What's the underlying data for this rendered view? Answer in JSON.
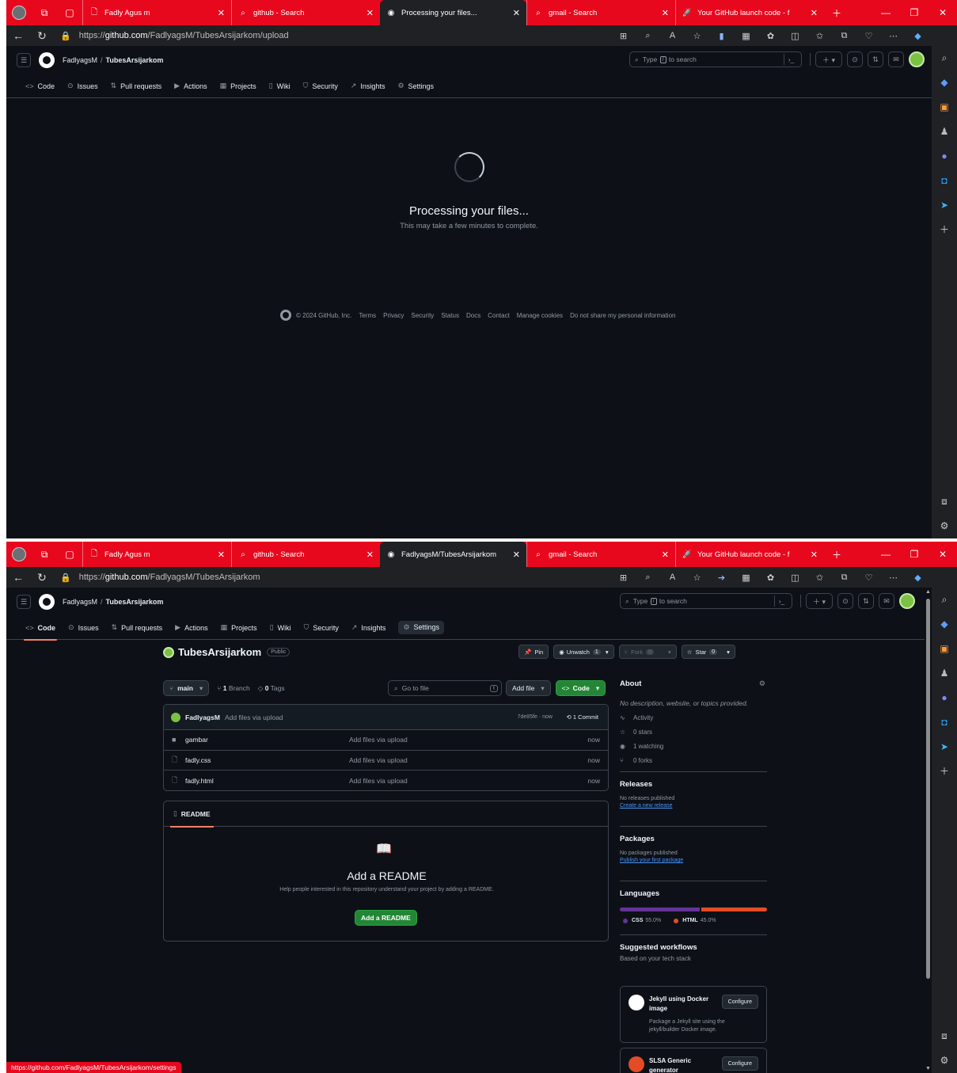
{
  "browser": {
    "tabs_top": [
      {
        "label": "Fadly Agus m",
        "icon": "page-icon"
      },
      {
        "label": "github - Search",
        "icon": "search-icon"
      },
      {
        "label": "Processing your files...",
        "icon": "github-icon",
        "active": true
      },
      {
        "label": "gmail - Search",
        "icon": "search-icon"
      },
      {
        "label": "Your GitHub launch code - f",
        "icon": "rocket-icon"
      }
    ],
    "tabs_bottom": [
      {
        "label": "Fadly Agus m",
        "icon": "page-icon"
      },
      {
        "label": "github - Search",
        "icon": "search-icon"
      },
      {
        "label": "FadlyagsM/TubesArsijarkom",
        "icon": "github-icon",
        "active": true
      },
      {
        "label": "gmail - Search",
        "icon": "search-icon"
      },
      {
        "label": "Your GitHub launch code - f",
        "icon": "rocket-icon"
      }
    ],
    "url_top": {
      "prefix": "https://",
      "host": "github.com",
      "path": "/FadlyagsM/TubesArsijarkom/upload"
    },
    "url_bottom": {
      "prefix": "https://",
      "host": "github.com",
      "path": "/FadlyagsM/TubesArsijarkom"
    },
    "status_url": "https://github.com/FadlyagsM/TubesArsijarkom/settings",
    "accent": "#e8081e"
  },
  "github": {
    "owner": "FadlyagsM",
    "repo": "TubesArsijarkom",
    "search": {
      "pre": "Type",
      "key": "/",
      "post": "to search"
    },
    "nav": [
      "Code",
      "Issues",
      "Pull requests",
      "Actions",
      "Projects",
      "Wiki",
      "Security",
      "Insights",
      "Settings"
    ]
  },
  "processing": {
    "title": "Processing your files...",
    "subtitle": "This may take a few minutes to complete."
  },
  "footer": {
    "copyright": "© 2024 GitHub, Inc.",
    "links": [
      "Terms",
      "Privacy",
      "Security",
      "Status",
      "Docs",
      "Contact",
      "Manage cookies",
      "Do not share my personal information"
    ]
  },
  "repo": {
    "visibility": "Public",
    "pin": "Pin",
    "unwatch": "Unwatch",
    "watch_count": "1",
    "fork": "Fork",
    "fork_count": "0",
    "star": "Star",
    "star_count": "0",
    "branch": "main",
    "branches": {
      "count": "1",
      "label": "Branch"
    },
    "tags": {
      "count": "0",
      "label": "Tags"
    },
    "goto_placeholder": "Go to file",
    "goto_key": "t",
    "add_file": "Add file",
    "code_btn": "Code",
    "commit": {
      "author": "FadlyagsM",
      "message": "Add files via upload",
      "hash": "7de85fe · now",
      "count": "1 Commit"
    },
    "files": [
      {
        "name": "gambar",
        "type": "folder",
        "message": "Add files via upload",
        "age": "now"
      },
      {
        "name": "fadly.css",
        "type": "file",
        "message": "Add files via upload",
        "age": "now"
      },
      {
        "name": "fadly.html",
        "type": "file",
        "message": "Add files via upload",
        "age": "now"
      }
    ],
    "readme": {
      "tab": "README",
      "title": "Add a README",
      "subtitle": "Help people interested in this repository understand your project by adding a README.",
      "button": "Add a README"
    },
    "about": {
      "title": "About",
      "description": "No description, website, or topics provided.",
      "stats": [
        "Activity",
        "0 stars",
        "1 watching",
        "0 forks"
      ]
    },
    "releases": {
      "title": "Releases",
      "text": "No releases published",
      "link": "Create a new release"
    },
    "packages": {
      "title": "Packages",
      "text": "No packages published",
      "link": "Publish your first package"
    },
    "languages": {
      "title": "Languages",
      "items": [
        {
          "name": "CSS",
          "percent": 55.0,
          "label": "55.0%",
          "color": "#663399"
        },
        {
          "name": "HTML",
          "percent": 45.0,
          "label": "45.0%",
          "color": "#e34c26"
        }
      ]
    },
    "workflows": {
      "title": "Suggested workflows",
      "subtitle": "Based on your tech stack",
      "items": [
        {
          "name": "Jekyll using Docker image",
          "desc": "Package a Jekyll site using the jekyll/builder Docker image.",
          "button": "Configure"
        },
        {
          "name": "SLSA Generic generator",
          "desc": "",
          "button": "Configure"
        }
      ]
    }
  }
}
